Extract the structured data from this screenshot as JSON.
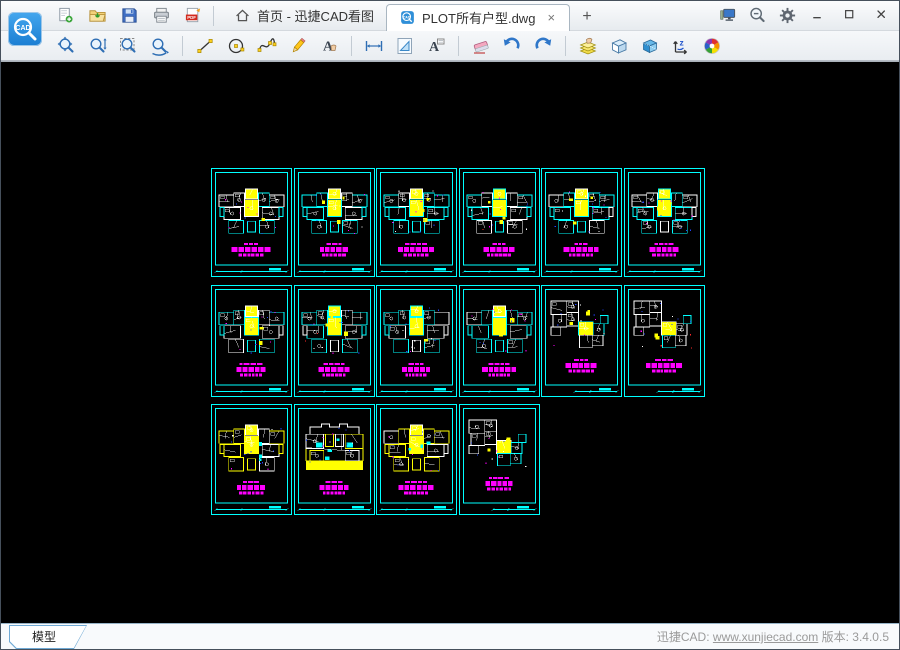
{
  "titlebar": {
    "file_actions": [
      {
        "name": "new-file",
        "icon": "new-file-icon"
      },
      {
        "name": "open-file",
        "icon": "open-folder-icon"
      },
      {
        "name": "save-file",
        "icon": "save-icon"
      },
      {
        "name": "print",
        "icon": "print-icon"
      },
      {
        "name": "export-pdf",
        "icon": "export-pdf-icon"
      }
    ],
    "tabs": [
      {
        "id": "home",
        "icon": "home-icon",
        "label": "首页 - 迅捷CAD看图",
        "active": false,
        "closable": false
      },
      {
        "id": "plot-dwg",
        "icon": "cad-file-icon",
        "label": "PLOT所有户型.dwg",
        "active": true,
        "closable": true
      }
    ],
    "tab_close_glyph": "×",
    "new_tab_glyph": "+",
    "right_actions": [
      {
        "name": "screen-device",
        "icon": "screen-device-icon"
      },
      {
        "name": "find-drawing",
        "icon": "search-minus-icon"
      },
      {
        "name": "settings",
        "icon": "settings-gear-icon"
      }
    ],
    "window_controls": [
      {
        "name": "minimize",
        "icon": "minimize-icon"
      },
      {
        "name": "maximize",
        "icon": "maximize-icon"
      },
      {
        "name": "close",
        "icon": "close-icon"
      }
    ]
  },
  "toolbar": {
    "items": [
      {
        "name": "pan-zoom",
        "icon": "pan-zoom-icon"
      },
      {
        "name": "zoom-realtime",
        "icon": "zoom-vertical-icon"
      },
      {
        "name": "zoom-window",
        "icon": "zoom-window-icon"
      },
      {
        "name": "zoom-previous",
        "icon": "zoom-previous-icon"
      },
      {
        "sep": true
      },
      {
        "name": "draw-line",
        "icon": "line-tool-icon"
      },
      {
        "name": "draw-circle",
        "icon": "circle-tool-icon"
      },
      {
        "name": "draw-polyline",
        "icon": "polyline-tool-icon"
      },
      {
        "name": "draw-freehand",
        "icon": "pencil-tool-icon"
      },
      {
        "name": "draw-text",
        "icon": "text-tool-icon"
      },
      {
        "sep": true
      },
      {
        "name": "measure-distance",
        "icon": "measure-distance-icon"
      },
      {
        "name": "measure-area",
        "icon": "measure-area-icon"
      },
      {
        "name": "text-annotation",
        "icon": "text-annotation-icon"
      },
      {
        "sep": true
      },
      {
        "name": "eraser",
        "icon": "eraser-icon"
      },
      {
        "name": "undo",
        "icon": "undo-icon"
      },
      {
        "name": "redo",
        "icon": "redo-icon"
      },
      {
        "sep": true
      },
      {
        "name": "layers",
        "icon": "layers-icon"
      },
      {
        "name": "box-3d",
        "icon": "box-3d-icon"
      },
      {
        "name": "view-3d",
        "icon": "view-3d-icon"
      },
      {
        "name": "axis-z",
        "icon": "axis-z-icon"
      },
      {
        "name": "background-color",
        "icon": "color-wheel-icon"
      }
    ]
  },
  "statusbar": {
    "model_tab": "模型",
    "brand": "迅捷CAD:",
    "link": "www.xunjiecad.com",
    "version": "版本: 3.4.0.5"
  },
  "colors": {
    "cad_cyan": "#00ffff",
    "cad_yellow": "#ffff00",
    "cad_magenta": "#ff00ff",
    "cad_white": "#ffffff",
    "cad_red": "#ff2a2a",
    "cad_blue": "#2244ff",
    "canvas_bg": "#000000"
  },
  "canvas": {
    "cells": [
      {
        "row": 0,
        "col": 0,
        "layout": "sym",
        "palette": "cyan",
        "accents": [
          "blue",
          "magenta"
        ],
        "seed": 101,
        "dim": "full"
      },
      {
        "row": 0,
        "col": 1,
        "layout": "sym",
        "palette": "cyan",
        "accents": [
          "blue",
          "magenta"
        ],
        "seed": 102,
        "dim": "full"
      },
      {
        "row": 0,
        "col": 2,
        "layout": "sym",
        "palette": "cyan",
        "accents": [
          "blue"
        ],
        "seed": 103,
        "dim": "full"
      },
      {
        "row": 0,
        "col": 3,
        "layout": "sym",
        "palette": "cyan",
        "accents": [
          "blue",
          "red"
        ],
        "seed": 104,
        "dim": "full"
      },
      {
        "row": 0,
        "col": 4,
        "layout": "sym",
        "palette": "cyan",
        "accents": [
          "magenta",
          "blue"
        ],
        "seed": 105,
        "dim": "full"
      },
      {
        "row": 0,
        "col": 5,
        "layout": "sym",
        "palette": "cyan",
        "accents": [
          "magenta",
          "blue"
        ],
        "seed": 106,
        "dim": "full"
      },
      {
        "row": 1,
        "col": 0,
        "layout": "sym",
        "palette": "cyan",
        "accents": [
          "magenta",
          "blue"
        ],
        "seed": 107,
        "dim": "full"
      },
      {
        "row": 1,
        "col": 1,
        "layout": "sym",
        "palette": "cyan",
        "accents": [
          "red",
          "blue"
        ],
        "seed": 108,
        "dim": "full"
      },
      {
        "row": 1,
        "col": 2,
        "layout": "sym",
        "palette": "cyan",
        "accents": [
          "blue"
        ],
        "seed": 109,
        "dim": "full"
      },
      {
        "row": 1,
        "col": 3,
        "layout": "sym",
        "palette": "cyan",
        "accents": [
          "blue",
          "magenta"
        ],
        "seed": 110,
        "dim": "full"
      },
      {
        "row": 1,
        "col": 4,
        "layout": "offset",
        "palette": "cyan",
        "accents": [
          "blue"
        ],
        "seed": 111,
        "dim": "right"
      },
      {
        "row": 1,
        "col": 5,
        "layout": "offset",
        "palette": "cyan",
        "accents": [
          "red",
          "blue"
        ],
        "seed": 112,
        "dim": "right"
      },
      {
        "row": 2,
        "col": 0,
        "layout": "sym",
        "palette": "yellow",
        "accents": [
          "red",
          "blue"
        ],
        "seed": 113,
        "dim": "full"
      },
      {
        "row": 2,
        "col": 1,
        "layout": "block",
        "palette": "yellow",
        "accents": [
          "blue"
        ],
        "seed": 114,
        "dim": "full"
      },
      {
        "row": 2,
        "col": 2,
        "layout": "sym",
        "palette": "yellow",
        "accents": [
          "blue"
        ],
        "seed": 115,
        "dim": "full"
      },
      {
        "row": 2,
        "col": 3,
        "layout": "offset",
        "palette": "cyan",
        "accents": [
          "blue",
          "magenta"
        ],
        "seed": 116,
        "dim": "right"
      }
    ]
  }
}
